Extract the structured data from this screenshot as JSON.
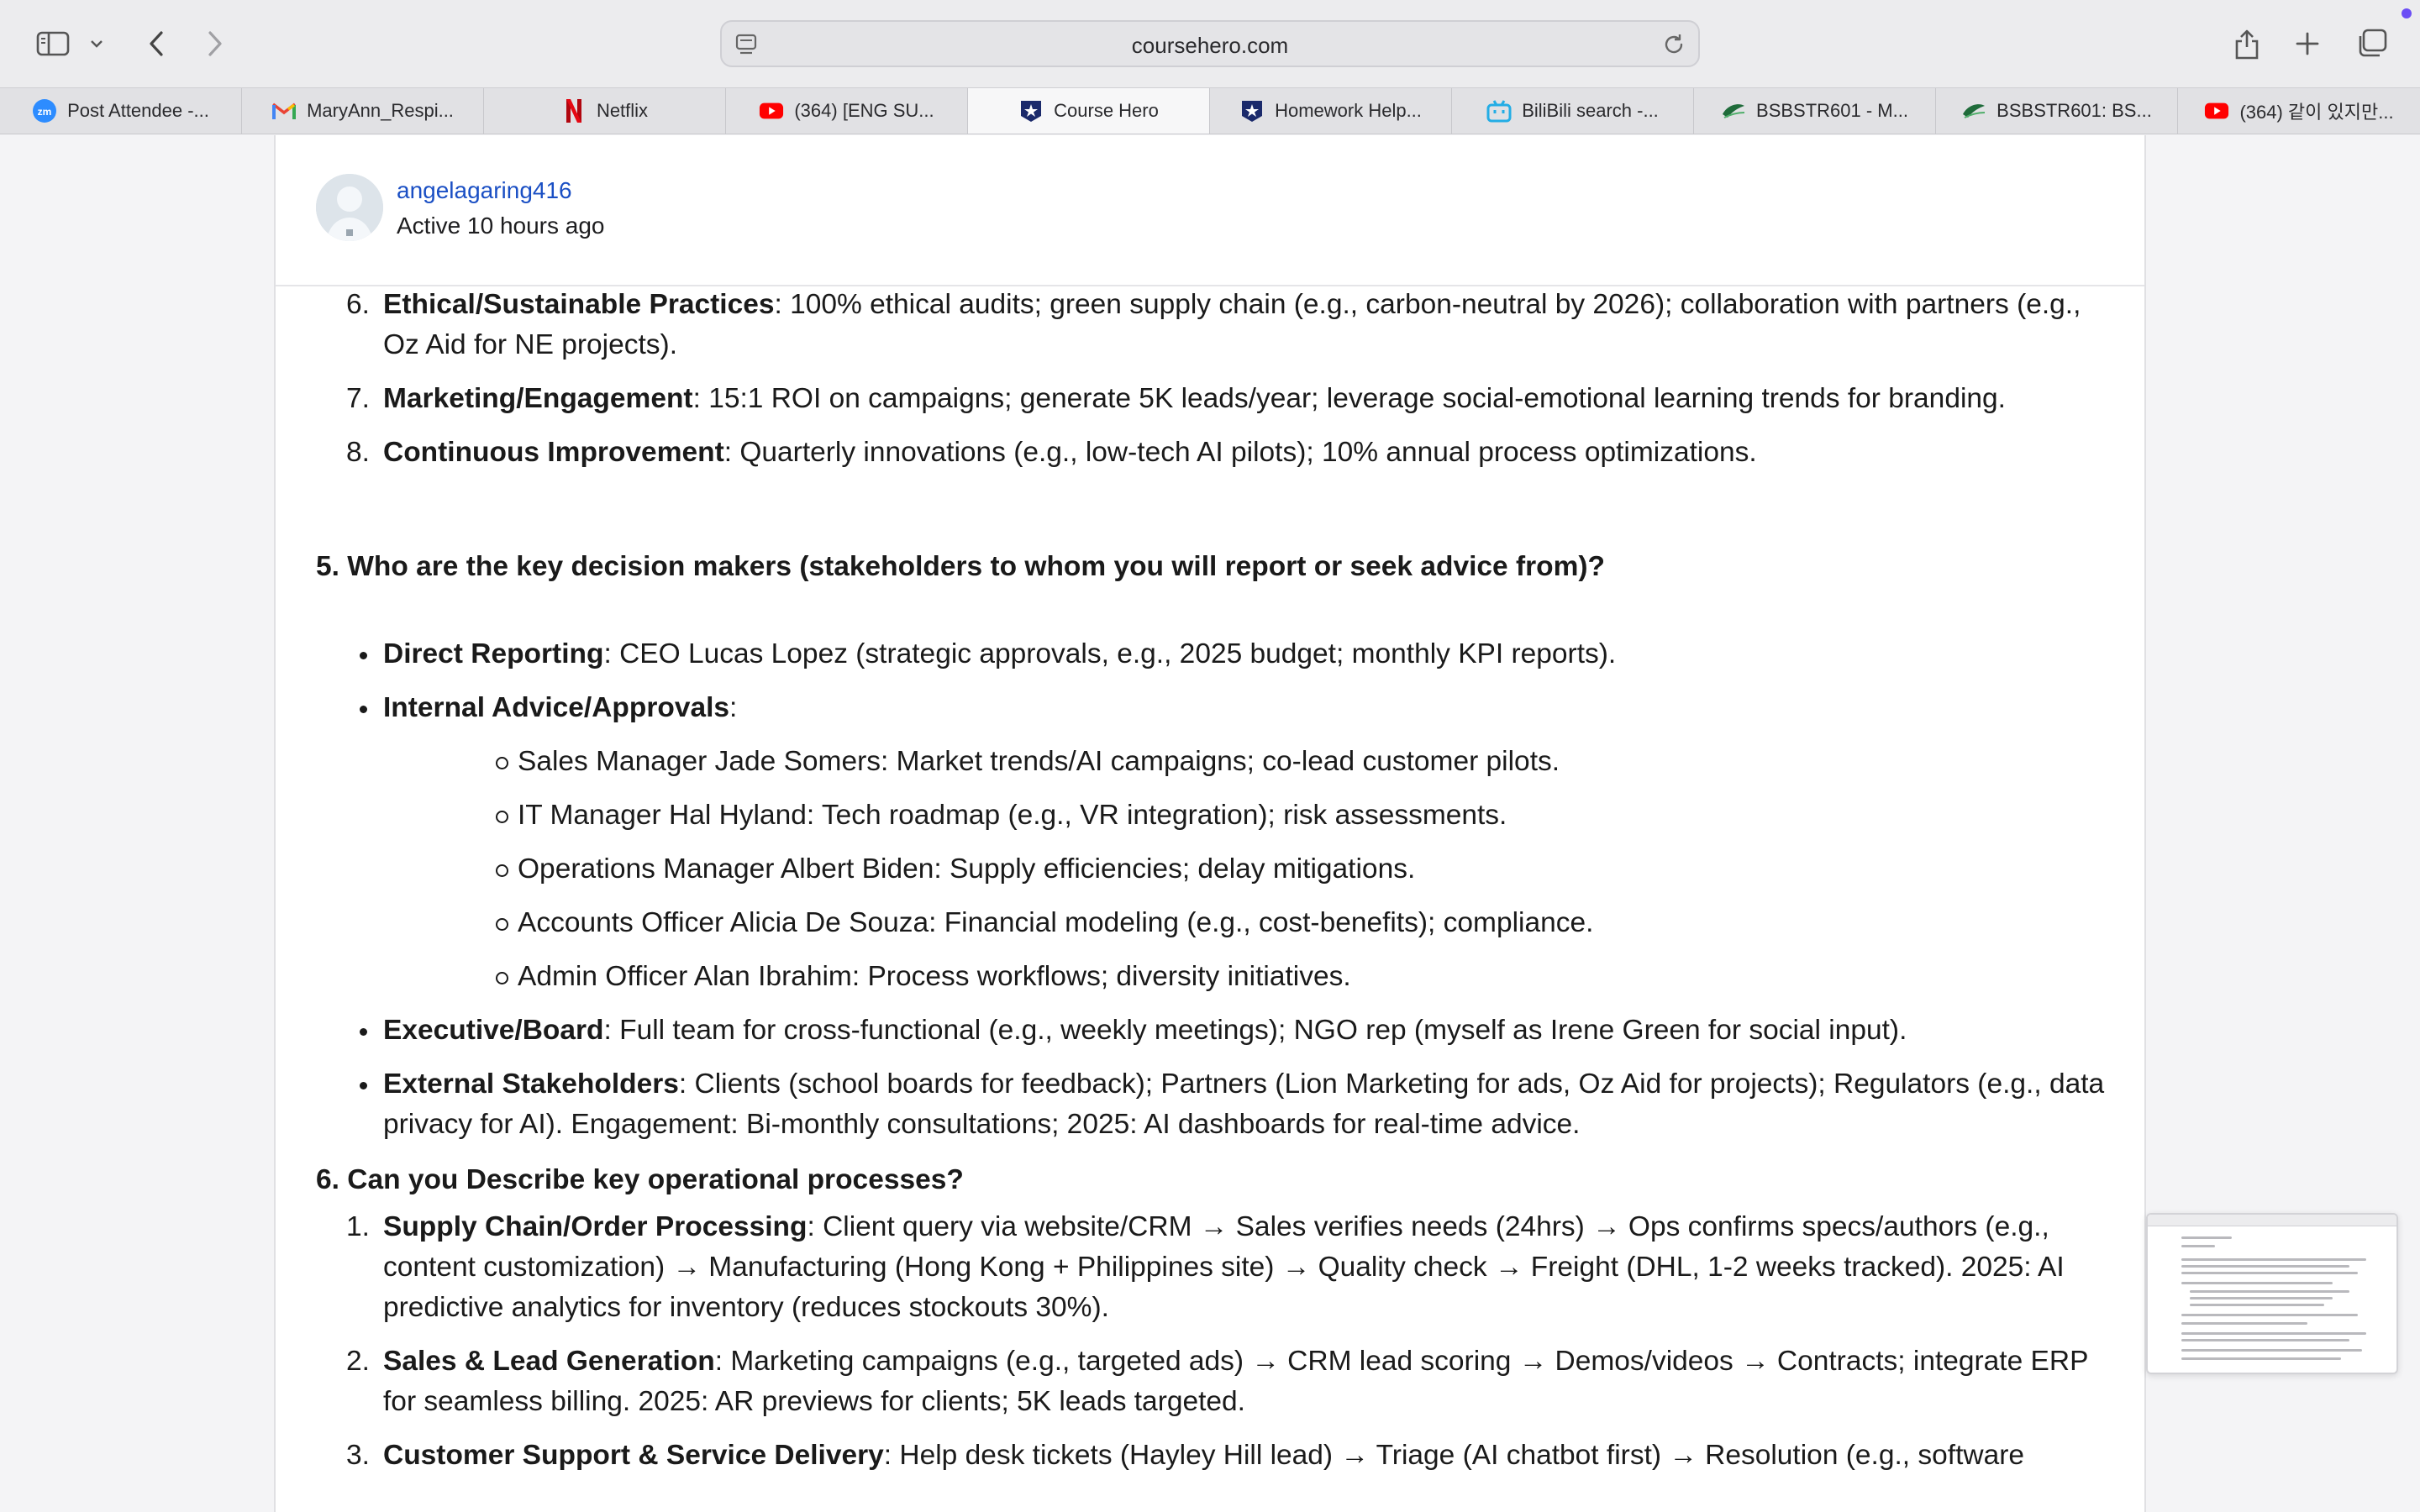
{
  "browser": {
    "url": "coursehero.com",
    "tabs": [
      {
        "label": "Post Attendee -...",
        "icon": "zoom-icon",
        "active": false
      },
      {
        "label": "MaryAnn_Respi...",
        "icon": "gmail-icon",
        "active": false
      },
      {
        "label": "Netflix",
        "icon": "netflix-icon",
        "active": false
      },
      {
        "label": "(364) [ENG SU...",
        "icon": "youtube-icon",
        "active": false
      },
      {
        "label": "Course Hero",
        "icon": "coursehero-icon",
        "active": true
      },
      {
        "label": "Homework Help...",
        "icon": "coursehero-icon",
        "active": false
      },
      {
        "label": "BiliBili search -...",
        "icon": "bilibili-icon",
        "active": false
      },
      {
        "label": "BSBSTR601 - M...",
        "icon": "leaf-icon",
        "active": false
      },
      {
        "label": "BSBSTR601: BS...",
        "icon": "leaf-icon",
        "active": false
      },
      {
        "label": "(364) 같이 있지만...",
        "icon": "youtube-icon",
        "active": false
      }
    ]
  },
  "author": {
    "username": "angelagaring416",
    "status": "Active 10 hours ago"
  },
  "content": {
    "list_top": [
      {
        "num": "6.",
        "term": "Ethical/Sustainable Practices",
        "text": ": 100% ethical audits; green supply chain (e.g., carbon-neutral by 2026); collaboration with partners (e.g., Oz Aid for NE projects)."
      },
      {
        "num": "7.",
        "term": "Marketing/Engagement",
        "text": ": 15:1 ROI on campaigns; generate 5K leads/year; leverage social-emotional learning trends for branding."
      },
      {
        "num": "8.",
        "term": "Continuous Improvement",
        "text": ": Quarterly innovations (e.g., low-tech AI pilots); 10% annual process optimizations."
      }
    ],
    "q5": "5. Who are the key decision makers (stakeholders to whom you will report or seek advice from)?",
    "q5_items": {
      "direct_term": "Direct Reporting",
      "direct_text": ": CEO Lucas Lopez (strategic approvals, e.g., 2025 budget; monthly KPI reports).",
      "internal_term": "Internal Advice/Approvals",
      "internal_text": ":",
      "internal_sub": [
        "Sales Manager Jade Somers: Market trends/AI campaigns; co-lead customer pilots.",
        "IT Manager Hal Hyland: Tech roadmap (e.g., VR integration); risk assessments.",
        "Operations Manager Albert Biden: Supply efficiencies; delay mitigations.",
        "Accounts Officer Alicia De Souza: Financial modeling (e.g., cost-benefits); compliance.",
        "Admin Officer Alan Ibrahim: Process workflows; diversity initiatives."
      ],
      "exec_term": "Executive/Board",
      "exec_text": ": Full team for cross-functional (e.g., weekly meetings); NGO rep (myself as Irene Green for social input).",
      "external_term": "External Stakeholders",
      "external_text": ": Clients (school boards for feedback); Partners (Lion Marketing for ads, Oz Aid for projects); Regulators (e.g., data privacy for AI). Engagement: Bi-monthly consultations; 2025: AI dashboards for real-time advice."
    },
    "q6": "6. Can you Describe key operational processes?",
    "q6_items": [
      {
        "num": "1.",
        "term": "Supply Chain/Order Processing",
        "text": ": Client query via website/CRM → Sales verifies needs (24hrs) → Ops confirms specs/authors (e.g., content customization) → Manufacturing (Hong Kong + Philippines site) → Quality check → Freight (DHL, 1-2 weeks tracked). 2025: AI predictive analytics for inventory (reduces stockouts 30%)."
      },
      {
        "num": "2.",
        "term": "Sales & Lead Generation",
        "text": ": Marketing campaigns (e.g., targeted ads) → CRM lead scoring → Demos/videos → Contracts; integrate ERP for seamless billing. 2025: AR previews for clients; 5K leads targeted."
      },
      {
        "num": "3.",
        "term": "Customer Support & Service Delivery",
        "text": ": Help desk tickets (Hayley Hill lead) → Triage (AI chatbot first) → Resolution (e.g., software"
      }
    ]
  }
}
